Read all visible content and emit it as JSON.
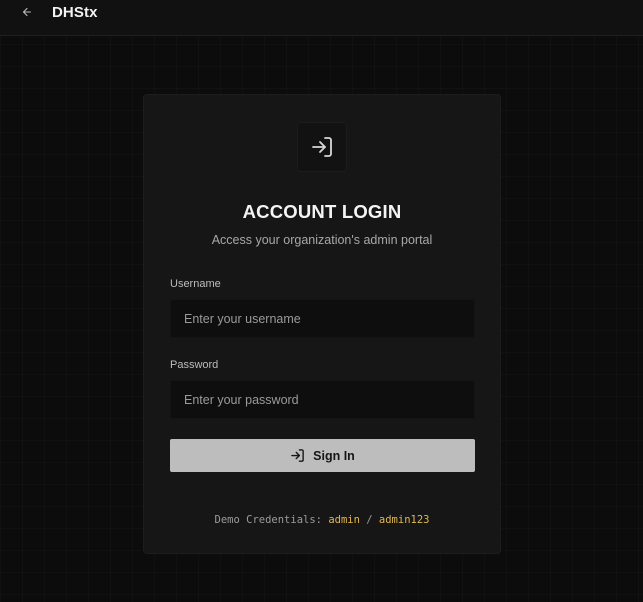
{
  "header": {
    "back_icon": "arrow-left-icon",
    "brand": "DHStx"
  },
  "login": {
    "badge_icon": "login-icon",
    "title": "ACCOUNT LOGIN",
    "subtitle": "Access your organization's admin portal",
    "username": {
      "label": "Username",
      "placeholder": "Enter your username",
      "value": ""
    },
    "password": {
      "label": "Password",
      "placeholder": "Enter your password",
      "value": ""
    },
    "submit_icon": "login-icon",
    "submit_label": "Sign In"
  },
  "demo": {
    "prefix": "Demo Credentials:",
    "user": "admin",
    "separator": "/",
    "pass": "admin123"
  },
  "colors": {
    "background": "#0c0c0c",
    "card": "#161616",
    "input": "#0e0e0e",
    "button": "#bdbdbd",
    "highlight": "#e2b64f"
  }
}
